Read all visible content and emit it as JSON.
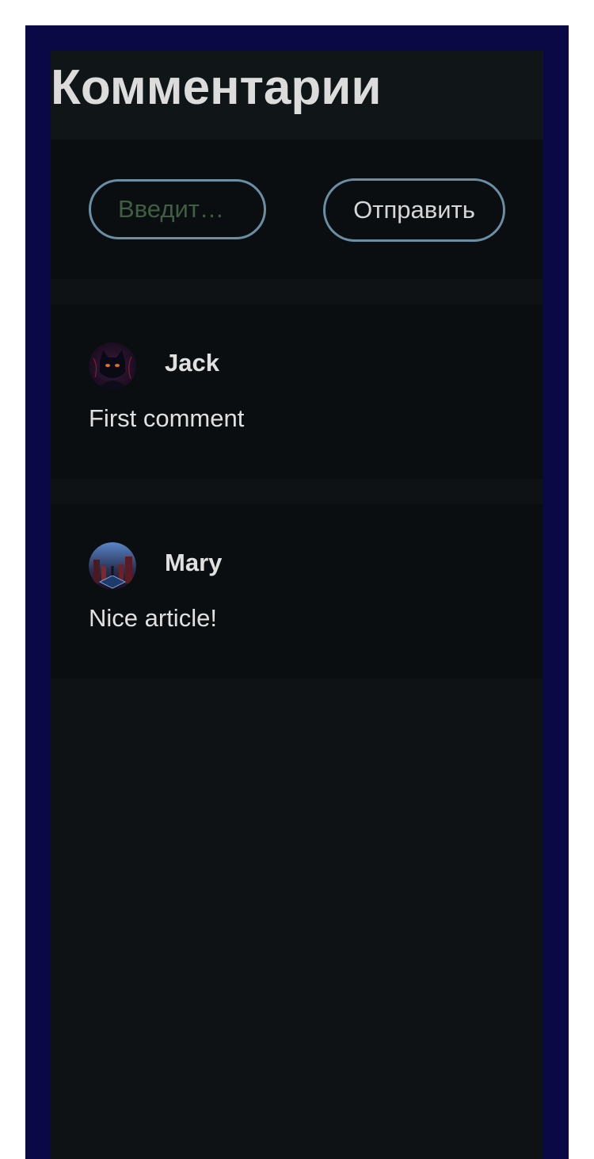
{
  "page": {
    "title": "Комментарии"
  },
  "comment_form": {
    "input_placeholder": "Введит…",
    "input_value": "",
    "send_label": "Отправить"
  },
  "comments": [
    {
      "author": "Jack",
      "text": "First comment",
      "avatar_icon": "black-cat-avatar"
    },
    {
      "author": "Mary",
      "text": "Nice article!",
      "avatar_icon": "night-city-avatar"
    }
  ],
  "colors": {
    "frame_background": "#0b0846",
    "panel_background": "#0e1215",
    "button_border": "#6a8ea3",
    "placeholder_text": "#3f5f42",
    "text": "#e0e0e0"
  }
}
